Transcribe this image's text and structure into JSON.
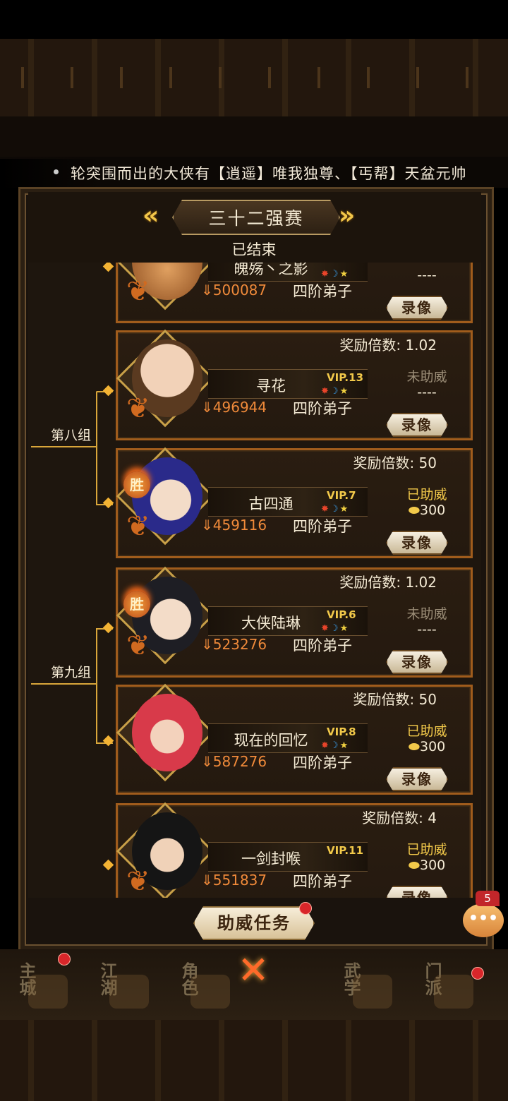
{
  "marquee": {
    "text": "轮突围而出的大侠有【逍遥】唯我独尊、【丐帮】天盆元帅"
  },
  "header": {
    "title": "三十二强赛",
    "status": "已结束",
    "prev_icon": "double-left-arrow-icon",
    "next_icon": "double-right-arrow-icon"
  },
  "groups": [
    {
      "label": "第八组"
    },
    {
      "label": "第九组"
    }
  ],
  "cards": [
    {
      "name": "魄殇丶之影",
      "power": "500087",
      "rank": "四阶弟子",
      "replay": "录像",
      "sup_line2": "----"
    },
    {
      "ratio": "奖励倍数: 1.02",
      "name": "寻花",
      "vip": "VIP.13",
      "power": "496944",
      "rank": "四阶弟子",
      "support": "未助威",
      "sup_line2": "----",
      "replay": "录像",
      "win": false
    },
    {
      "ratio": "奖励倍数: 50",
      "name": "古四通",
      "vip": "VIP.7",
      "power": "459116",
      "rank": "四阶弟子",
      "support": "已助威",
      "sup_line2": "300",
      "replay": "录像",
      "win": true,
      "win_label": "胜"
    },
    {
      "ratio": "奖励倍数: 1.02",
      "name": "大侠陆琳",
      "vip": "VIP.6",
      "power": "523276",
      "rank": "四阶弟子",
      "support": "未助威",
      "sup_line2": "----",
      "replay": "录像",
      "win": true,
      "win_label": "胜"
    },
    {
      "ratio": "奖励倍数: 50",
      "name": "现在的回忆",
      "vip": "VIP.8",
      "power": "587276",
      "rank": "四阶弟子",
      "support": "已助威",
      "sup_line2": "300",
      "replay": "录像",
      "win": false
    },
    {
      "ratio": "奖励倍数: 4",
      "name": "一剑封喉",
      "vip": "VIP.11",
      "power": "551837",
      "rank": "四阶弟子",
      "support": "已助威",
      "sup_line2": "300",
      "replay": "录像",
      "win": false
    }
  ],
  "bottom": {
    "support_task": "助威任务",
    "chat_badge": "5"
  },
  "nav": [
    {
      "label": "主城"
    },
    {
      "label": "江湖"
    },
    {
      "label": "角色"
    },
    {
      "label": "武学"
    },
    {
      "label": "门派"
    }
  ],
  "colors": {
    "accent": "#f3b334",
    "card_border": "#a05c1c",
    "supported": "#f2c94a",
    "power": "#f08a3a"
  }
}
